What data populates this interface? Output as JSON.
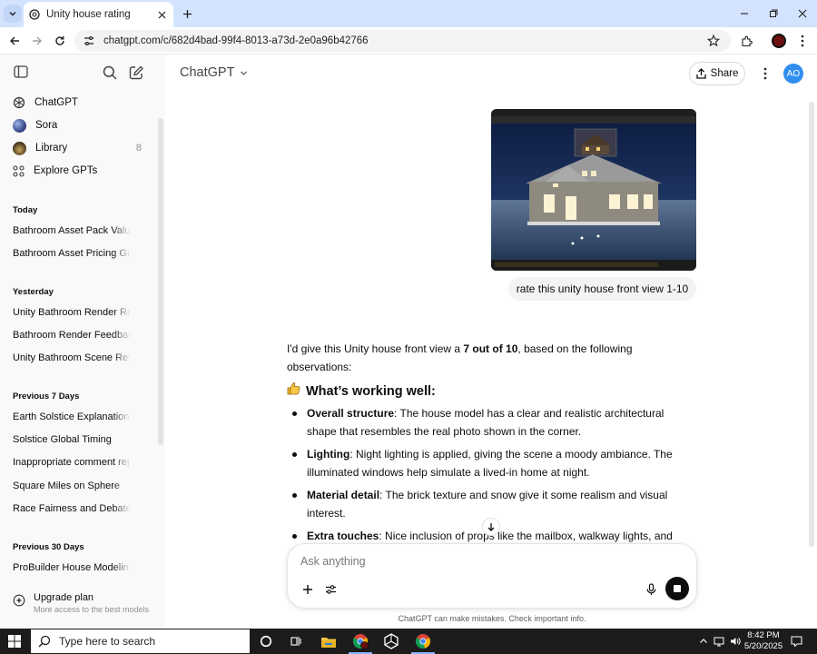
{
  "browser": {
    "tab_title": "Unity house rating",
    "url": "chatgpt.com/c/682d4bad-99f4-8013-a73d-2e0a96b42766"
  },
  "sidebar": {
    "nav": [
      {
        "label": "ChatGPT",
        "count": ""
      },
      {
        "label": "Sora",
        "count": ""
      },
      {
        "label": "Library",
        "count": "8"
      },
      {
        "label": "Explore GPTs",
        "count": ""
      }
    ],
    "sections": [
      {
        "title": "Today",
        "items": [
          "Bathroom Asset Pack Value",
          "Bathroom Asset Pricing Guide"
        ]
      },
      {
        "title": "Yesterday",
        "items": [
          "Unity Bathroom Render Review",
          "Bathroom Render Feedback",
          "Unity Bathroom Scene Review"
        ]
      },
      {
        "title": "Previous 7 Days",
        "items": [
          "Earth Solstice Explanation",
          "Solstice Global Timing",
          "Inappropriate comment report",
          "Square Miles on Sphere",
          "Race Fairness and Debate"
        ]
      },
      {
        "title": "Previous 30 Days",
        "items": [
          "ProBuilder House Modeling Tips"
        ]
      }
    ],
    "upgrade": {
      "title": "Upgrade plan",
      "subtitle": "More access to the best models"
    }
  },
  "header": {
    "model": "ChatGPT",
    "share_label": "Share",
    "avatar_initials": "AO"
  },
  "conversation": {
    "user_message": "rate this unity house front view 1-10",
    "reply": {
      "intro_prefix": "I'd give this Unity house front view a ",
      "intro_score": "7 out of 10",
      "intro_suffix": ", based on the following observations:",
      "heading": "What’s working well:",
      "bullets": [
        {
          "title": "Overall structure",
          "text": ": The house model has a clear and realistic architectural shape that resembles the real photo shown in the corner."
        },
        {
          "title": "Lighting",
          "text": ": Night lighting is applied, giving the scene a moody ambiance. The illuminated windows help simulate a lived-in home at night."
        },
        {
          "title": "Material detail",
          "text": ": The brick texture and snow give it some realism and visual interest."
        },
        {
          "title": "Extra touches",
          "text": ": Nice inclusion of props like the mailbox, walkway lights, and holiday-style decorations."
        }
      ]
    }
  },
  "composer": {
    "placeholder": "Ask anything",
    "disclaimer": "ChatGPT can make mistakes. Check important info."
  },
  "taskbar": {
    "search_placeholder": "Type here to search",
    "time": "8:42 PM",
    "date": "5/20/2025"
  },
  "colors": {
    "tabbar": "#d3e3fd",
    "sidebar": "#f9f9f9",
    "avatar": "#2f8ef0",
    "taskbar": "#1c1c1c"
  }
}
